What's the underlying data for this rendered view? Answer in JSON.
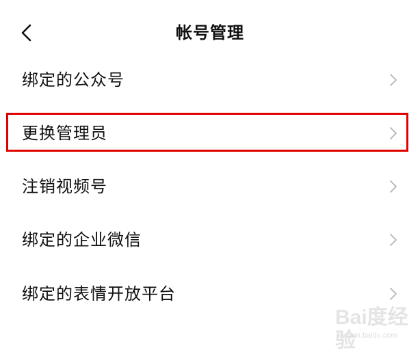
{
  "header": {
    "title": "帐号管理",
    "back_icon": "chevron-left-icon"
  },
  "menu": {
    "items": [
      {
        "label": "绑定的公众号",
        "icon": "chevron-right-icon"
      },
      {
        "label": "更换管理员",
        "icon": "chevron-right-icon",
        "highlighted": true
      },
      {
        "label": "注销视频号",
        "icon": "chevron-right-icon"
      },
      {
        "label": "绑定的企业微信",
        "icon": "chevron-right-icon"
      },
      {
        "label": "绑定的表情开放平台",
        "icon": "chevron-right-icon"
      }
    ]
  },
  "colors": {
    "background": "#ffffff",
    "text": "#111111",
    "chevron": "#b3b3b3",
    "highlight": "#e00000"
  },
  "watermark": {
    "logo_text": "Bai度经验",
    "site": "jingyan.baidu.com"
  }
}
